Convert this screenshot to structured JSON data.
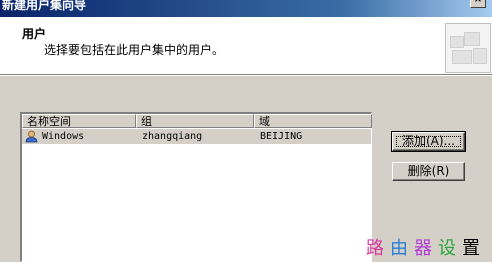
{
  "window": {
    "title": "新建用户集向导",
    "close_label": "×"
  },
  "header": {
    "title": "用户",
    "description": "选择要包括在此用户集中的用户。"
  },
  "list": {
    "columns": [
      "名称空间",
      "组",
      "域"
    ],
    "rows": [
      {
        "namespace": "Windows",
        "group": "zhangqiang",
        "domain": "BEIJING",
        "icon": "user-icon"
      }
    ]
  },
  "buttons": {
    "add": "添加(A)...",
    "remove": "删除(R)"
  },
  "watermark": [
    "路",
    "由",
    "器",
    "设",
    "置"
  ]
}
